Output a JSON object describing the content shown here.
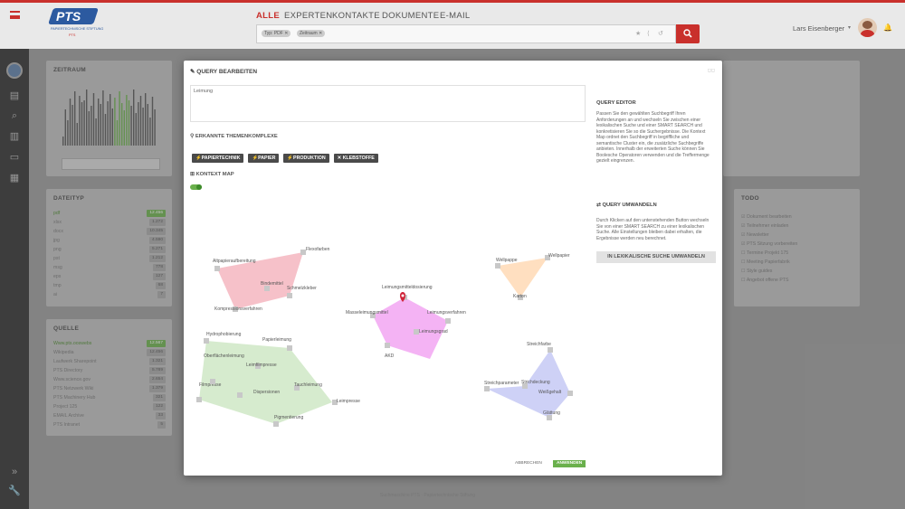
{
  "header": {
    "logo_text": "PTS",
    "logo_sub": "PAPIERTECHNISCHE STIFTUNG",
    "logo_sub2": "PTS",
    "nav": [
      {
        "label": "ALLE",
        "active": true
      },
      {
        "label": "EXPERTEN"
      },
      {
        "label": "KONTAKTE"
      },
      {
        "label": "DOKUMENTE"
      },
      {
        "label": "E-MAIL"
      }
    ],
    "search_tags": [
      "Typ: PDF",
      "Zeitraum"
    ],
    "user_name": "Lars Eisenberger"
  },
  "panels": {
    "zeitraum": {
      "title": "ZEITRAUM"
    },
    "dateityp": {
      "title": "DATEITYP",
      "rows": [
        {
          "label": "pdf",
          "value": "12.456"
        },
        {
          "label": "xlsx",
          "value": "1.272"
        },
        {
          "label": "docx",
          "value": "10.345"
        },
        {
          "label": "jpg",
          "value": "4.590"
        },
        {
          "label": "png",
          "value": "5.271"
        },
        {
          "label": "pst",
          "value": "1.212"
        },
        {
          "label": "msg",
          "value": "778"
        },
        {
          "label": "eps",
          "value": "127"
        },
        {
          "label": "tmp",
          "value": "68"
        },
        {
          "label": "ai",
          "value": "7"
        }
      ]
    },
    "quelle": {
      "title": "QUELLE",
      "rows": [
        {
          "label": "Www.pts.ooswebs",
          "value": "12.567"
        },
        {
          "label": "Wikipedia",
          "value": "12.456"
        },
        {
          "label": "Laufwerk Sharepoint",
          "value": "1.321"
        },
        {
          "label": "PTS Directory",
          "value": "5.789"
        },
        {
          "label": "Www.science.gov",
          "value": "2.654"
        },
        {
          "label": "PTS Netzwerk Wiki",
          "value": "1.379"
        },
        {
          "label": "PTS Machinery Hub",
          "value": "321"
        },
        {
          "label": "Project 125",
          "value": "122"
        },
        {
          "label": "EMAIL Archive",
          "value": "33"
        },
        {
          "label": "PTS Intranet",
          "value": "5"
        }
      ]
    },
    "todo": {
      "title": "TODO",
      "items": [
        "Dokument bearbeiten",
        "Teilnehmer einladen",
        "Newsletter",
        "PTS Sitzung vorbereiten",
        "Termine Projekt 175",
        "Meeting Papierfabrik",
        "Style guides",
        "Angebot offene PTS"
      ]
    }
  },
  "modal": {
    "title": "QUERY BEARBEITEN",
    "query_value": "Leimung",
    "topics_title": "ERKANNTE THEMENKOMPLEXE",
    "topics": [
      "PAPIERTECHNIK",
      "PAPIER",
      "PRODUKTION",
      "KLEBSTOFFE"
    ],
    "kontext_title": "KONTEXT MAP",
    "info_title": "QUERY EDITOR",
    "info_text": "Passen Sie den gewählten Suchbegriff Ihren Anforderungen an und wechseln Sie zwischen einer lexikalischen Suche und einer SMART SEARCH und konkretisieren Sie so die Suchergebnisse. Die Kontext Map ordnet den Suchbegriff in begriffliche und semantische Cluster ein, die zusätzliche Suchbegriffe anbieten. Innerhalb der erweiterten Suche können Sie Boolesche Operatoren verwenden und die Treffermenge gezielt eingrenzen.",
    "convert_title": "QUERY UMWANDELN",
    "convert_text": "Durch Klicken auf den untenstehenden Button wechseln Sie von einer SMART SEARCH zu einer lexikalischen Suche. Alle Einstellungen bleiben dabei erhalten, die Ergebnisse werden neu berechnet.",
    "convert_button": "IN LEXIKALISCHE SUCHE UMWANDELN",
    "cancel": "ABBRECHEN",
    "apply": "ANWENDEN"
  },
  "context_map": {
    "clusters": [
      {
        "color": "#f4b6bf",
        "labels": [
          "Altpapieraufbereitung",
          "Flexofarben",
          "Bindemittel",
          "Schmelzkleber",
          "Kompressionsverfahren"
        ]
      },
      {
        "color": "#ffd9b5",
        "labels": [
          "Wellpappe",
          "Wellpapier",
          "Karton"
        ]
      },
      {
        "color": "#f2a6f2",
        "labels": [
          "Leimungsmitteldosierung",
          "Leimungsverfahren",
          "Leimungsgrad",
          "AKD",
          "Masseleimungsmittel"
        ]
      },
      {
        "color": "#cfe8c6",
        "labels": [
          "Hydrophobierung",
          "Papierleimung",
          "Oberflächenleimung",
          "Leimpresse",
          "Pigmentierung",
          "Filmpresse",
          "Leimfilmpresse",
          "Dispersionen",
          "Tauchleimung"
        ]
      },
      {
        "color": "#c6c9f4",
        "labels": [
          "Strichdeckung",
          "Streichfarbe",
          "Weißgehalt",
          "Glättung",
          "Streichparameter"
        ]
      }
    ]
  },
  "footer": "Suchmaschine PTS · Papiertechnische Stiftung"
}
